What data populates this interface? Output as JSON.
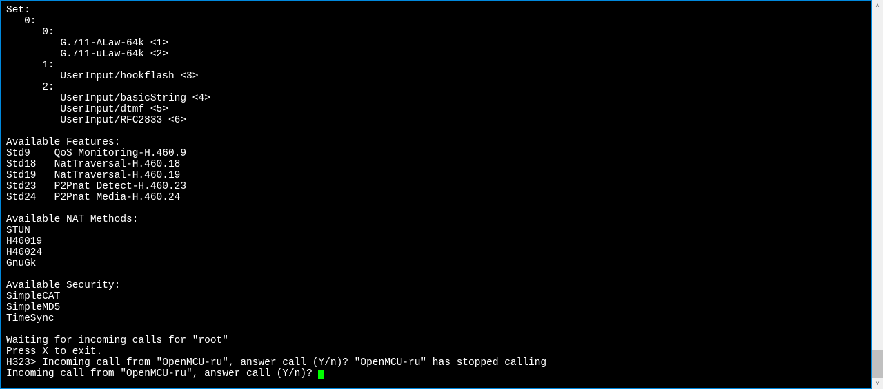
{
  "terminal": {
    "lines": [
      "Set:",
      "   0:",
      "      0:",
      "         G.711-ALaw-64k <1>",
      "         G.711-uLaw-64k <2>",
      "      1:",
      "         UserInput/hookflash <3>",
      "      2:",
      "         UserInput/basicString <4>",
      "         UserInput/dtmf <5>",
      "         UserInput/RFC2833 <6>",
      "",
      "Available Features:",
      "Std9    QoS Monitoring-H.460.9",
      "Std18   NatTraversal-H.460.18",
      "Std19   NatTraversal-H.460.19",
      "Std23   P2Pnat Detect-H.460.23",
      "Std24   P2Pnat Media-H.460.24",
      "",
      "Available NAT Methods:",
      "STUN",
      "H46019",
      "H46024",
      "GnuGk",
      "",
      "Available Security:",
      "SimpleCAT",
      "SimpleMD5",
      "TimeSync",
      "",
      "Waiting for incoming calls for \"root\"",
      "Press X to exit.",
      "H323> Incoming call from \"OpenMCU-ru\", answer call (Y/n)? \"OpenMCU-ru\" has stopped calling"
    ],
    "prompt": "Incoming call from \"OpenMCU-ru\", answer call (Y/n)? "
  },
  "scrollbar": {
    "up_glyph": "˄",
    "down_glyph": "˅"
  }
}
